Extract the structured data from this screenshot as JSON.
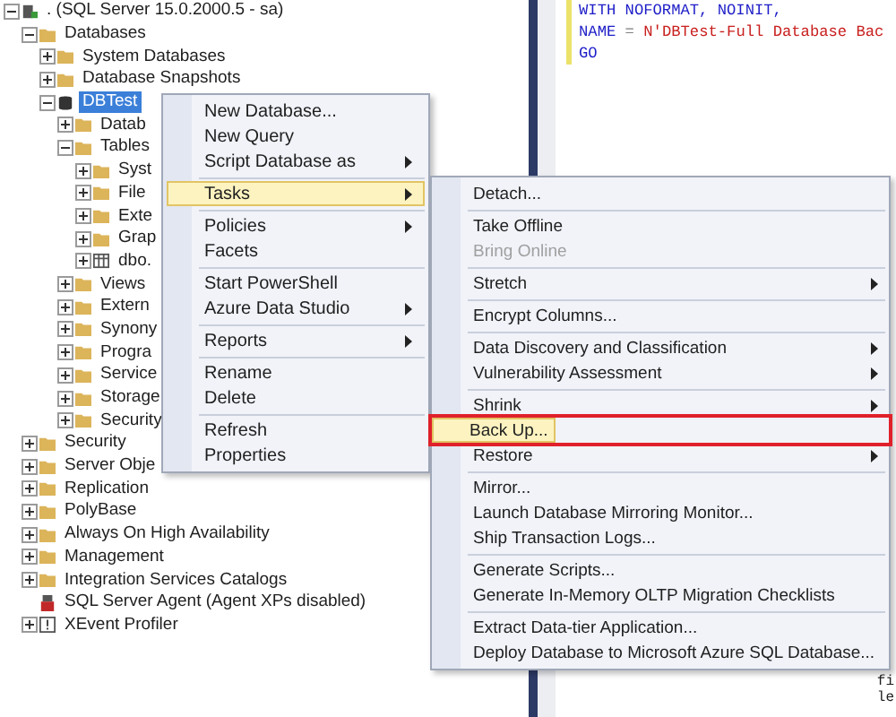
{
  "tree": [
    {
      "label": ". (SQL Server 15.0.2000.5 - sa)",
      "kind": "server",
      "expanded": true,
      "selected": false,
      "children": [
        {
          "label": "Databases",
          "kind": "folder",
          "expanded": true,
          "selected": false,
          "children": [
            {
              "label": "System Databases",
              "kind": "folder",
              "expanded": false,
              "selected": false
            },
            {
              "label": "Database Snapshots",
              "kind": "folder",
              "expanded": false,
              "selected": false
            },
            {
              "label": "DBTest",
              "kind": "database",
              "expanded": true,
              "selected": true,
              "children": [
                {
                  "label": "Datab",
                  "kind": "folder",
                  "expanded": false,
                  "selected": false
                },
                {
                  "label": "Tables",
                  "kind": "folder",
                  "expanded": true,
                  "selected": false,
                  "children": [
                    {
                      "label": "Syst",
                      "kind": "folder",
                      "expanded": false,
                      "selected": false
                    },
                    {
                      "label": "File",
                      "kind": "folder",
                      "expanded": false,
                      "selected": false
                    },
                    {
                      "label": "Exte",
                      "kind": "folder",
                      "expanded": false,
                      "selected": false
                    },
                    {
                      "label": "Grap",
                      "kind": "folder",
                      "expanded": false,
                      "selected": false
                    },
                    {
                      "label": "dbo.",
                      "kind": "table",
                      "expanded": false,
                      "selected": false
                    }
                  ]
                },
                {
                  "label": "Views",
                  "kind": "folder",
                  "expanded": false,
                  "selected": false
                },
                {
                  "label": "Extern",
                  "kind": "folder",
                  "expanded": false,
                  "selected": false
                },
                {
                  "label": "Synony",
                  "kind": "folder",
                  "expanded": false,
                  "selected": false
                },
                {
                  "label": "Progra",
                  "kind": "folder",
                  "expanded": false,
                  "selected": false
                },
                {
                  "label": "Service",
                  "kind": "folder",
                  "expanded": false,
                  "selected": false
                },
                {
                  "label": "Storage",
                  "kind": "folder",
                  "expanded": false,
                  "selected": false
                },
                {
                  "label": "Security",
                  "kind": "folder",
                  "expanded": false,
                  "selected": false
                }
              ]
            }
          ]
        },
        {
          "label": "Security",
          "kind": "folder",
          "expanded": false,
          "selected": false
        },
        {
          "label": "Server Obje",
          "kind": "folder",
          "expanded": false,
          "selected": false
        },
        {
          "label": "Replication",
          "kind": "folder",
          "expanded": false,
          "selected": false
        },
        {
          "label": "PolyBase",
          "kind": "folder",
          "expanded": false,
          "selected": false
        },
        {
          "label": "Always On High Availability",
          "kind": "folder",
          "expanded": false,
          "selected": false
        },
        {
          "label": "Management",
          "kind": "folder",
          "expanded": false,
          "selected": false
        },
        {
          "label": "Integration Services Catalogs",
          "kind": "folder",
          "expanded": false,
          "selected": false
        },
        {
          "label": "SQL Server Agent (Agent XPs disabled)",
          "kind": "agent",
          "selected": false
        },
        {
          "label": "XEvent Profiler",
          "kind": "profiler",
          "expanded": false,
          "selected": false
        }
      ]
    }
  ],
  "editor": {
    "lines": [
      [
        {
          "text": "WITH NOFORMAT, NOINIT,",
          "kind": "keyword"
        }
      ],
      [
        {
          "text": "NAME",
          "kind": "keyword"
        },
        {
          "text": " = ",
          "kind": "operator"
        },
        {
          "text": "N'DBTest-Full Database Bac",
          "kind": "string"
        }
      ],
      [
        {
          "text": "GO",
          "kind": "keyword"
        }
      ]
    ],
    "fragments": [
      "fi",
      "le"
    ]
  },
  "context_menu": {
    "groups": [
      [
        {
          "label": "New Database...",
          "submenu": false,
          "selected": false
        },
        {
          "label": "New Query",
          "submenu": false,
          "selected": false
        },
        {
          "label": "Script Database as",
          "submenu": true,
          "selected": false
        }
      ],
      [
        {
          "label": "Tasks",
          "submenu": true,
          "selected": true
        }
      ],
      [
        {
          "label": "Policies",
          "submenu": true,
          "selected": false
        },
        {
          "label": "Facets",
          "submenu": false,
          "selected": false
        }
      ],
      [
        {
          "label": "Start PowerShell",
          "submenu": false,
          "selected": false
        },
        {
          "label": "Azure Data Studio",
          "submenu": true,
          "selected": false
        }
      ],
      [
        {
          "label": "Reports",
          "submenu": true,
          "selected": false
        }
      ],
      [
        {
          "label": "Rename",
          "submenu": false,
          "selected": false
        },
        {
          "label": "Delete",
          "submenu": false,
          "selected": false
        }
      ],
      [
        {
          "label": "Refresh",
          "submenu": false,
          "selected": false
        },
        {
          "label": "Properties",
          "submenu": false,
          "selected": false
        }
      ]
    ]
  },
  "tasks_menu": {
    "groups": [
      [
        {
          "label": "Detach...",
          "submenu": false,
          "selected": false,
          "disabled": false,
          "outlined": false
        }
      ],
      [
        {
          "label": "Take Offline",
          "submenu": false,
          "selected": false,
          "disabled": false,
          "outlined": false
        },
        {
          "label": "Bring Online",
          "submenu": false,
          "selected": false,
          "disabled": true,
          "outlined": false
        }
      ],
      [
        {
          "label": "Stretch",
          "submenu": true,
          "selected": false,
          "disabled": false,
          "outlined": false
        }
      ],
      [
        {
          "label": "Encrypt Columns...",
          "submenu": false,
          "selected": false,
          "disabled": false,
          "outlined": false
        }
      ],
      [
        {
          "label": "Data Discovery and Classification",
          "submenu": true,
          "selected": false,
          "disabled": false,
          "outlined": false
        },
        {
          "label": "Vulnerability Assessment",
          "submenu": true,
          "selected": false,
          "disabled": false,
          "outlined": false
        }
      ],
      [
        {
          "label": "Shrink",
          "submenu": true,
          "selected": false,
          "disabled": false,
          "outlined": false
        },
        {
          "label": "Back Up...",
          "submenu": false,
          "selected": true,
          "disabled": false,
          "outlined": true
        },
        {
          "label": "Restore",
          "submenu": true,
          "selected": false,
          "disabled": false,
          "outlined": false
        }
      ],
      [
        {
          "label": "Mirror...",
          "submenu": false,
          "selected": false,
          "disabled": false,
          "outlined": false
        },
        {
          "label": "Launch Database Mirroring Monitor...",
          "submenu": false,
          "selected": false,
          "disabled": false,
          "outlined": false
        },
        {
          "label": "Ship Transaction Logs...",
          "submenu": false,
          "selected": false,
          "disabled": false,
          "outlined": false
        }
      ],
      [
        {
          "label": "Generate Scripts...",
          "submenu": false,
          "selected": false,
          "disabled": false,
          "outlined": false
        },
        {
          "label": "Generate In-Memory OLTP Migration Checklists",
          "submenu": false,
          "selected": false,
          "disabled": false,
          "outlined": false
        }
      ],
      [
        {
          "label": "Extract Data-tier Application...",
          "submenu": false,
          "selected": false,
          "disabled": false,
          "outlined": false
        },
        {
          "label": "Deploy Database to Microsoft Azure SQL Database...",
          "submenu": false,
          "selected": false,
          "disabled": false,
          "outlined": false
        }
      ]
    ]
  }
}
